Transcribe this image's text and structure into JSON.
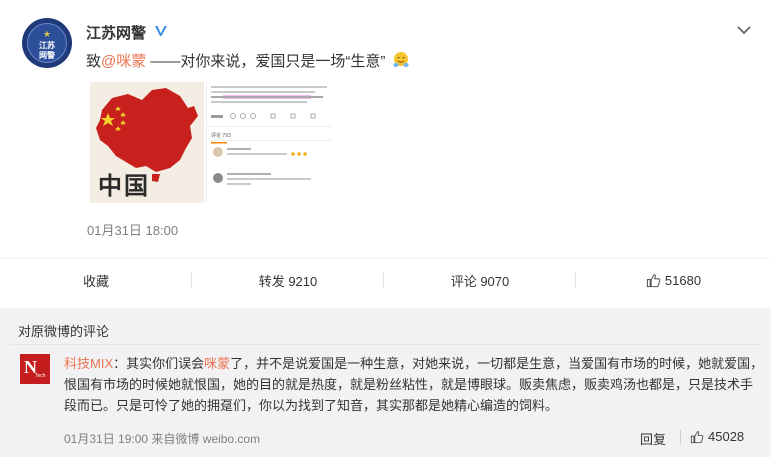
{
  "post": {
    "user_name": "江苏网警",
    "avatar_text": [
      "江苏",
      "网警"
    ],
    "text_prefix": "致",
    "mention": "@咪蒙",
    "text_suffix": " ——对你来说，爱国只是一场“生意”",
    "time": "01月31日 18:00",
    "image_1_caption": "中国",
    "image_2_tab": "评论 793"
  },
  "actions": {
    "favorite": "收藏",
    "forward": "转发 9210",
    "comment": "评论 9070",
    "like": "51680"
  },
  "comments": {
    "heading": "对原微博的评论",
    "items": [
      {
        "avatar_letter": "N",
        "avatar_sub": "Tech",
        "user": "科技MIX",
        "colon": "：",
        "part1": "其实你们误会",
        "mention": "咪蒙",
        "part2": "了，并不是说爱国是一种生意，对她来说，一切都是生意，当爱国有市场的时候，她就爱国，恨国有市场的时候她就恨国，她的目的就是热度，就是粉丝粘性，就是博眼球。贩卖焦虑，贩卖鸡汤也都是，只是技术手段而已。只是可怜了她的拥趸们，你以为找到了知音，其实那都是她精心编造的饲料。",
        "meta": "01月31日 19:00 来自微博 weibo.com",
        "reply_label": "回复",
        "likes": "45028"
      }
    ]
  },
  "colors": {
    "accent_orange": "#eb7350",
    "map_red": "#c8201c",
    "verified_blue": "#3a8ee6",
    "comment_bg": "#f2f2f5"
  }
}
